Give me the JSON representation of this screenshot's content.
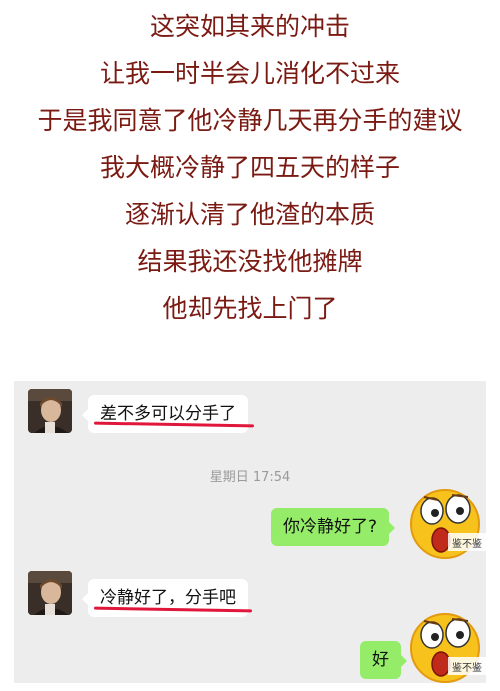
{
  "caption_lines": [
    "这突如其来的冲击",
    "让我一时半会儿消化不过来",
    "于是我同意了他冷静几天再分手的建议",
    "我大概冷静了四五天的样子",
    "逐渐认清了他渣的本质",
    "结果我还没找他摊牌",
    "他却先找上门了"
  ],
  "chat": {
    "messages": [
      {
        "side": "left",
        "text": "差不多可以分手了",
        "underlined": true
      },
      {
        "side": "right",
        "text": "你冷静好了?"
      },
      {
        "side": "left",
        "text": "冷静好了，分手吧",
        "underlined": true
      },
      {
        "side": "right",
        "text": "好"
      }
    ],
    "timestamp": "星期日 17:54",
    "emoji_sticker_text": "鉴不鉴"
  },
  "colors": {
    "caption": "#7a1a12",
    "chat_bg": "#ededed",
    "bubble_self": "#95ec69",
    "underline": "#e0163a"
  }
}
